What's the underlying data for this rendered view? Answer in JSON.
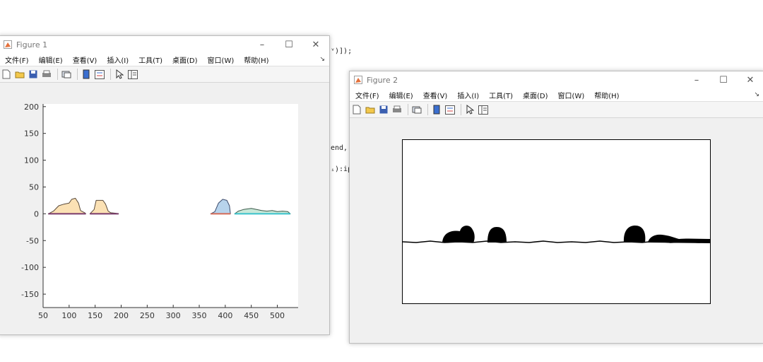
{
  "background_code": {
    "line1": "ᵛ)]);",
    "line2": "end,",
    "line3": "ᵢ):ip",
    "line4": ":"
  },
  "menus": [
    "文件(F)",
    "编辑(E)",
    "查看(V)",
    "插入(I)",
    "工具(T)",
    "桌面(D)",
    "窗口(W)",
    "帮助(H)"
  ],
  "figure1": {
    "title": "Figure 1",
    "chart_data": {
      "type": "area",
      "xlim": [
        50,
        540
      ],
      "ylim": [
        -175,
        205
      ],
      "xticks": [
        50,
        100,
        150,
        200,
        250,
        300,
        350,
        400,
        450,
        500
      ],
      "yticks": [
        200,
        150,
        100,
        50,
        0,
        -50,
        -100,
        -150
      ],
      "grid": false,
      "legend": "none",
      "shapes": [
        {
          "fill": "#fbe1b4",
          "outline": "#5a4a3a",
          "base": "#7a3b6b",
          "x": [
            60,
            70,
            80,
            90,
            100,
            105,
            112,
            118,
            122,
            130,
            132
          ],
          "y": [
            0,
            5,
            15,
            18,
            20,
            27,
            29,
            20,
            6,
            2,
            0
          ]
        },
        {
          "fill": "#fbe1b4",
          "outline": "#5a4a3a",
          "base": "#7a3b6b",
          "x": [
            140,
            148,
            152,
            165,
            170,
            175,
            180,
            190,
            195
          ],
          "y": [
            0,
            8,
            25,
            25,
            18,
            5,
            2,
            1,
            0
          ]
        },
        {
          "fill": "#b7d3ec",
          "outline": "#3b4a6b",
          "base": "#d46a56",
          "x": [
            372,
            380,
            387,
            395,
            403,
            408,
            410
          ],
          "y": [
            0,
            4,
            20,
            27,
            25,
            15,
            0
          ]
        },
        {
          "fill": "#c8e8d9",
          "outline": "#3b5a4a",
          "base": "#39c2cb",
          "x": [
            418,
            425,
            435,
            450,
            460,
            470,
            480,
            490,
            500,
            510,
            520,
            525
          ],
          "y": [
            0,
            5,
            8,
            10,
            8,
            6,
            5,
            6,
            4,
            5,
            4,
            0
          ]
        }
      ]
    }
  },
  "figure2": {
    "title": "Figure 2",
    "image_description_colors": {
      "foreground": "#000000",
      "background": "#ffffff"
    }
  },
  "colors": {
    "titlebar": "#ffffff",
    "window": "#f0f0f0",
    "matlab_icon": "#e4713c"
  }
}
